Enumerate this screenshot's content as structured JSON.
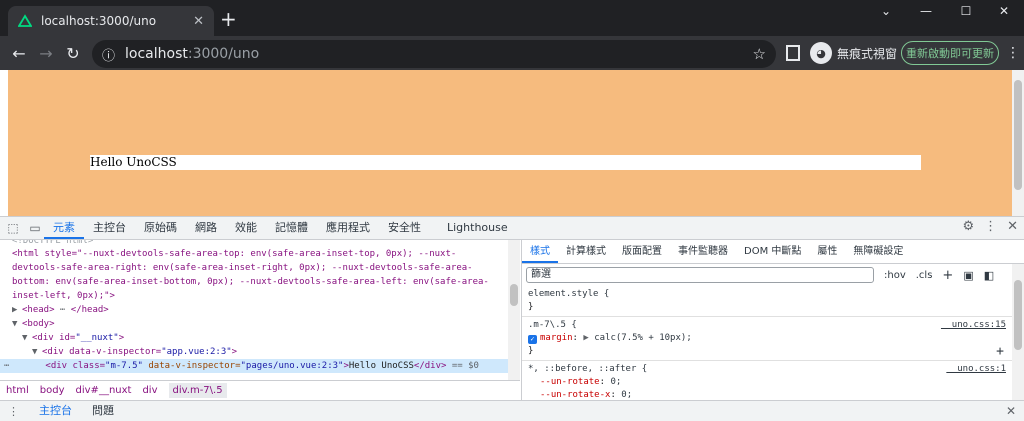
{
  "browser": {
    "tab_title": "localhost:3000/uno",
    "url_host": "localhost",
    "url_rest": ":3000/uno",
    "incognito_label": "無痕式視窗",
    "update_label": "重新啟動即可更新"
  },
  "page": {
    "hello_text": "Hello UnoCSS"
  },
  "devtools": {
    "tabs": [
      "元素",
      "主控台",
      "原始碼",
      "網路",
      "效能",
      "記憶體",
      "應用程式",
      "安全性",
      "Lighthouse"
    ],
    "elements": {
      "doctype": "<!DOCTYPE html>",
      "html_line": "<html style=\"--nuxt-devtools-safe-area-top: env(safe-area-inset-top, 0px); --nuxt-devtools-safe-area-right: env(safe-area-inset-right, 0px); --nuxt-devtools-safe-area-bottom: env(safe-area-inset-bottom, 0px); --nuxt-devtools-safe-area-left: env(safe-area-inset-left, 0px);\">",
      "head_line": "<head>",
      "head_close": "</head>",
      "body_line": "<body>",
      "nuxt_line_tag": "<div id=",
      "nuxt_line_val": "\"__nuxt\"",
      "app_line_tag": "<div data-v-inspector=",
      "app_line_val": "\"app.vue:2:3\"",
      "sel_line_tag": "<div class=",
      "sel_line_class": "\"m-7.5\"",
      "sel_line_attr": " data-v-inspector=",
      "sel_line_val": "\"pages/uno.vue:2:3\"",
      "sel_line_text": "Hello UnoCSS",
      "sel_line_close": "</div>",
      "sel_line_eq": " == $0"
    },
    "breadcrumbs": [
      "html",
      "body",
      "div#__nuxt",
      "div",
      "div.m-7\\.5"
    ],
    "styles_tabs": [
      "樣式",
      "計算樣式",
      "版面配置",
      "事件監聽器",
      "DOM 中斷點",
      "屬性",
      "無障礙設定"
    ],
    "filter_placeholder": "篩選",
    "filter_buttons": [
      ":hov",
      ".cls"
    ],
    "rules": {
      "element_style": "element.style {",
      "m75_selector": ".m-7\\.5 {",
      "m75_source": "__uno.css:15",
      "m75_prop": "margin",
      "m75_value": "calc(7.5% + 10px);",
      "star_selector": "*, ::before, ::after {",
      "star_source": "__uno.css:1",
      "star_prop1": "--un-rotate",
      "star_val1": "0;",
      "star_prop2": "--un-rotate-x",
      "star_val2": "0;",
      "close": "}"
    },
    "drawer_tabs": [
      "主控台",
      "問題"
    ]
  }
}
